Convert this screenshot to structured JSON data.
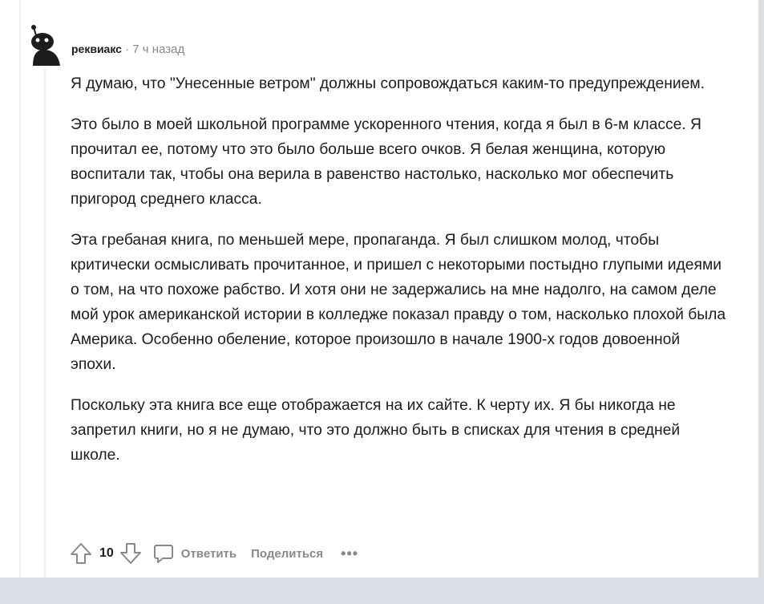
{
  "comment": {
    "username": "реквиакс",
    "separator": "·",
    "time": "7 ч назад",
    "paragraphs": [
      "Я думаю, что \"Унесенные ветром\" должны сопровождаться каким-то предупреждением.",
      "Это было в моей школьной программе ускоренного чтения, когда я был в 6-м классе. Я прочитал ее, потому что это было больше всего очков. Я белая женщина, которую воспитали так, чтобы она верила в равенство настолько, насколько мог обеспечить пригород среднего класса.",
      "Эта гребаная книга, по меньшей мере, пропаганда. Я был слишком молод, чтобы критически осмысливать прочитанное, и пришел с некоторыми постыдно глупыми идеями о том, на что похоже рабство. И хотя они не задержались на мне надолго, на самом деле мой урок американской истории в колледже показал правду о том, насколько плохой была Америка. Особенно обеление, которое произошло в начале 1900-х годов довоенной эпохи.",
      "Поскольку эта книга все еще отображается на их сайте. К черту их. Я бы никогда не запретил книги, но я не думаю, что это должно быть в списках для чтения в средней школе."
    ]
  },
  "actions": {
    "score": "10",
    "reply_label": "Ответить",
    "share_label": "Поделиться",
    "more_label": "•••"
  },
  "icons": {
    "avatar": "snoo-avatar-icon",
    "upvote": "upvote-arrow-icon",
    "downvote": "downvote-arrow-icon",
    "reply": "comment-bubble-icon"
  },
  "colors": {
    "text": "#1c1c1c",
    "meta": "#878a8c",
    "thread_line": "#edeff1"
  }
}
